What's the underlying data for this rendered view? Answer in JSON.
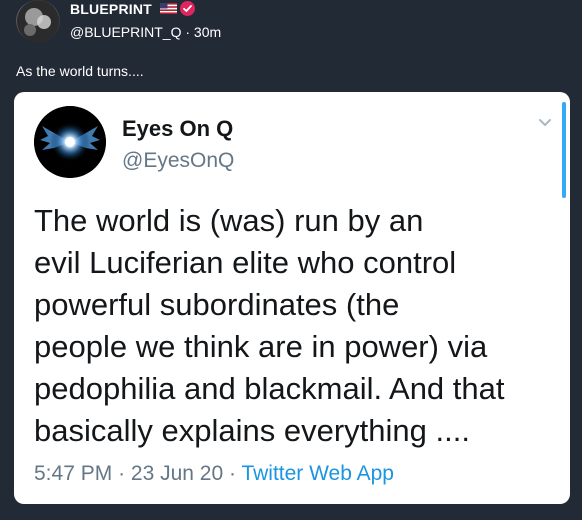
{
  "post": {
    "author_name": "BLUEPRINT",
    "handle_time": "@BLUEPRINT_Q · 30m",
    "caption": "As the world turns....",
    "icons": [
      "us-flag-icon",
      "verified-badge-icon"
    ],
    "verified_color": "#e0245e"
  },
  "quoted": {
    "name": "Eyes On Q",
    "handle": "@EyesOnQ",
    "text": "The world is (was) run by an\nevil Luciferian elite who control\npowerful subordinates (the\npeople we think are in power) via\npedophilia and blackmail. And that\nbasically explains everything ....",
    "time": "5:47 PM",
    "date": "23 Jun 20",
    "source": "Twitter Web App",
    "source_color": "#1b95e0"
  }
}
